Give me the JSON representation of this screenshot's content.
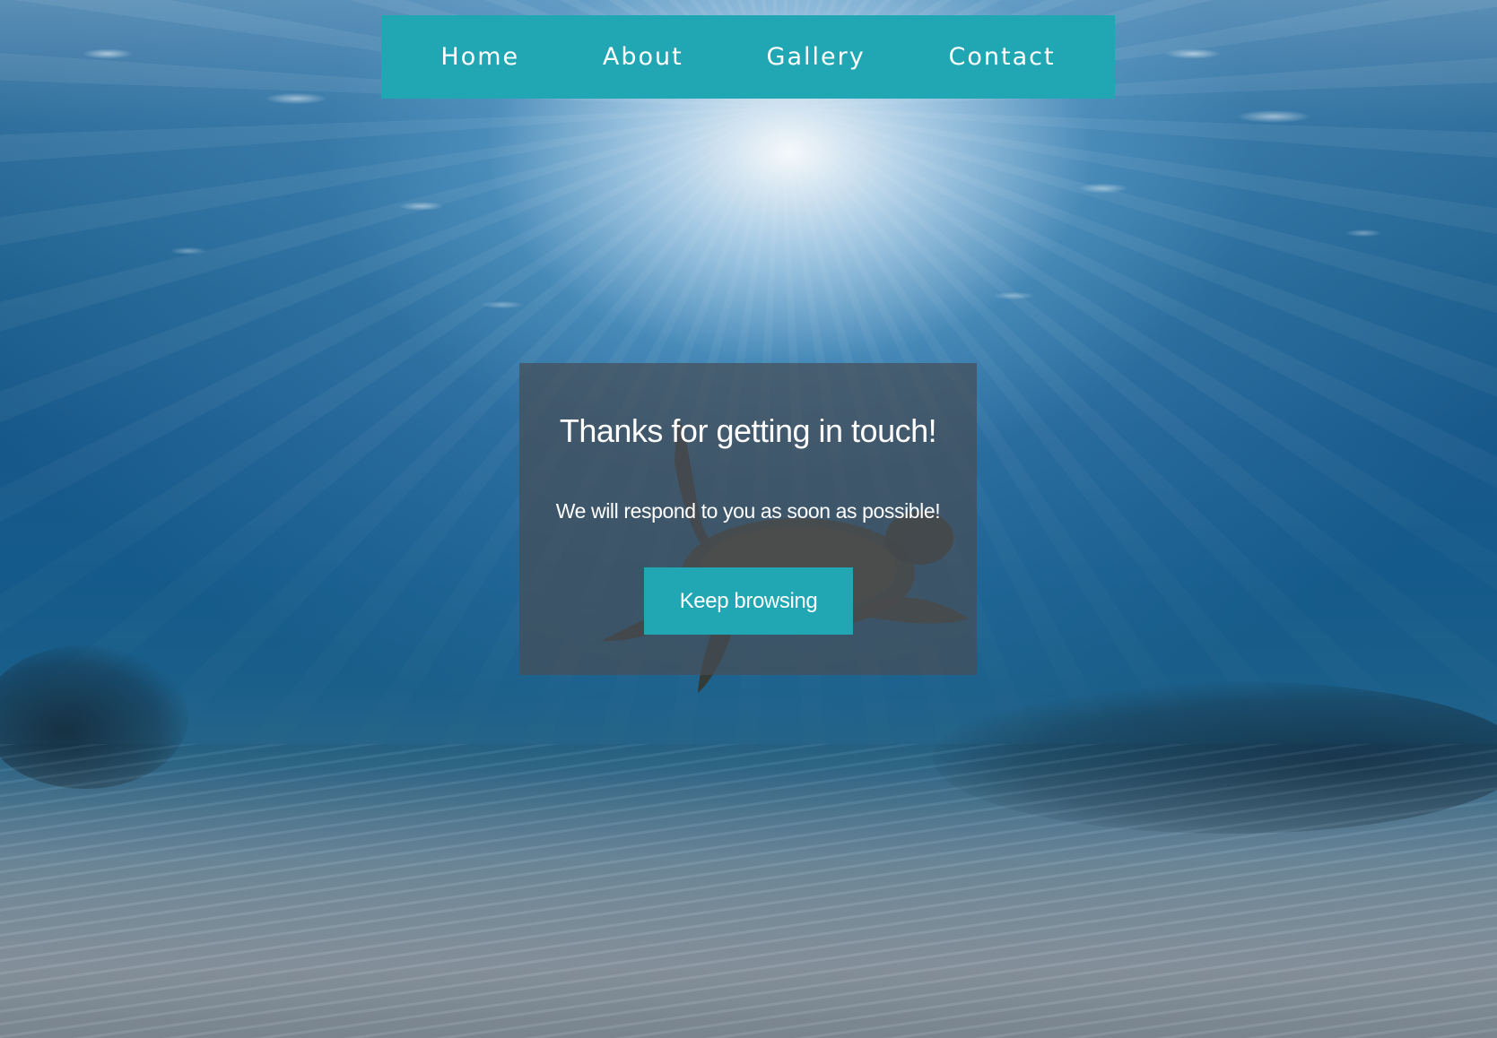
{
  "nav": {
    "items": [
      {
        "label": "Home"
      },
      {
        "label": "About"
      },
      {
        "label": "Gallery"
      },
      {
        "label": "Contact"
      }
    ]
  },
  "confirmation": {
    "title": "Thanks for getting in touch!",
    "message": "We will respond to you as soon as possible!",
    "button_label": "Keep browsing"
  },
  "colors": {
    "accent": "#21a6b3",
    "card_background": "rgba(70,78,86,0.72)",
    "text": "#ffffff"
  },
  "background": {
    "scene": "underwater-sea-turtle"
  }
}
